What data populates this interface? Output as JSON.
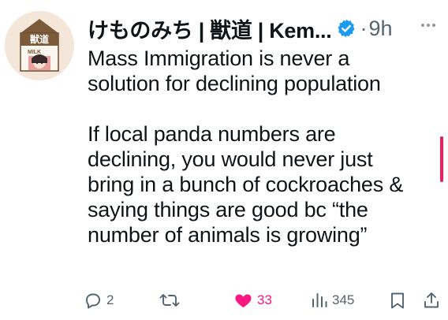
{
  "tweet": {
    "author": {
      "display_name": "けものみち | 獣道 | Kem...",
      "verified": true,
      "avatar_icon": "milk-carton-avatar",
      "avatar_carton_text": "獣道",
      "avatar_milk_label": "MILK"
    },
    "separator": "·",
    "time": "9h",
    "more_icon": "ellipsis-icon",
    "text": {
      "paragraph1": [
        "Mass Immigration is never a",
        "solution for declining population"
      ],
      "paragraph2": [
        "If local panda numbers are",
        "declining, you would never just",
        "bring in a bunch of cockroaches &",
        "saying things are good bc “the",
        "number of animals is growing”"
      ]
    },
    "actions": {
      "reply": {
        "icon": "reply-icon",
        "count": "2"
      },
      "retweet": {
        "icon": "retweet-icon",
        "count": ""
      },
      "like": {
        "icon": "heart-icon",
        "count": "33",
        "liked": true
      },
      "views": {
        "icon": "views-icon",
        "count": "345"
      },
      "bookmark": {
        "icon": "bookmark-icon"
      },
      "share": {
        "icon": "share-icon"
      }
    }
  },
  "colors": {
    "text": "#0f1419",
    "muted": "#536471",
    "verified": "#1d9bf0",
    "like": "#f91880",
    "scroll_indicator": "#e0245e"
  }
}
